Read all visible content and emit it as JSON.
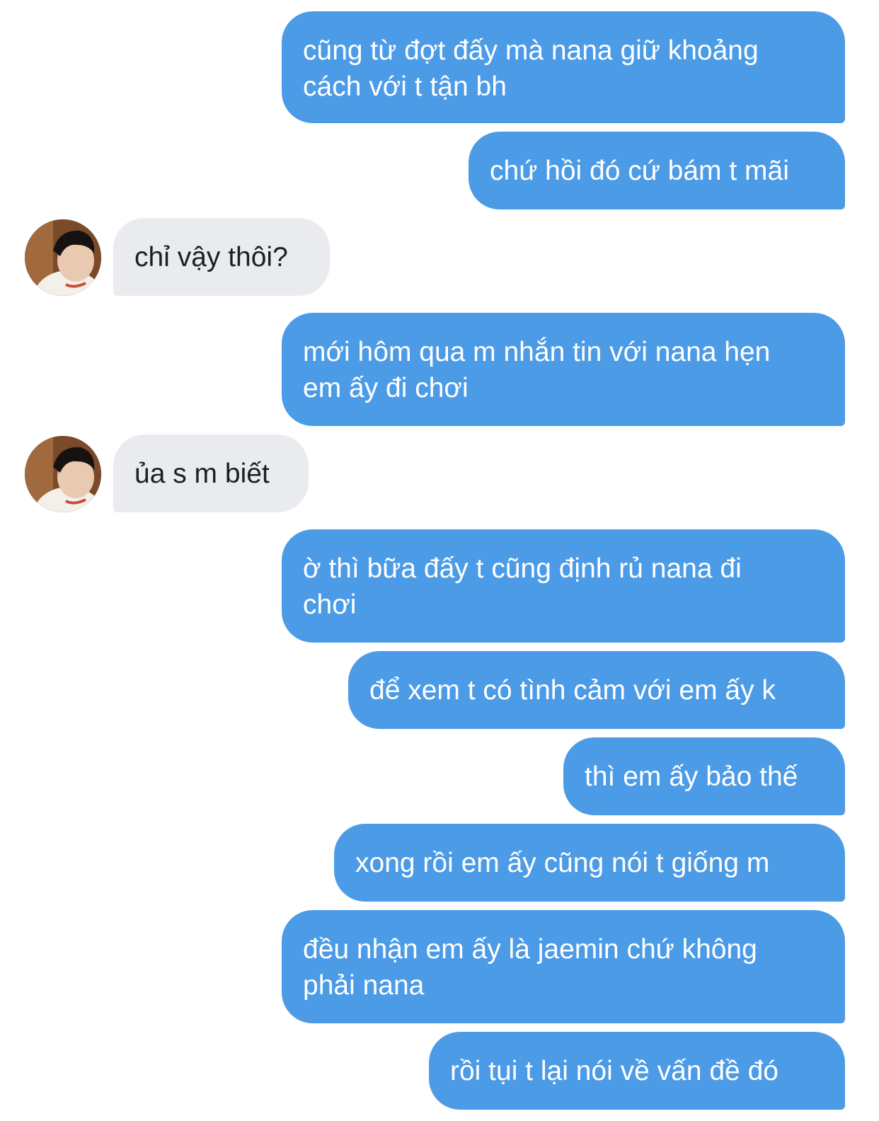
{
  "conversation": {
    "messages": [
      {
        "sender": "me",
        "text": "cũng từ đợt đấy mà nana giữ khoảng\ncách với t tận bh"
      },
      {
        "sender": "me",
        "text": "chứ hồi đó cứ bám t mãi"
      },
      {
        "sender": "them",
        "text": "chỉ vậy thôi?"
      },
      {
        "sender": "me",
        "text": "mới hôm qua m nhắn tin với nana hẹn\nem ấy đi chơi"
      },
      {
        "sender": "them",
        "text": "ủa s m biết"
      },
      {
        "sender": "me",
        "text": "ờ thì bữa đấy t cũng định rủ nana đi\nchơi"
      },
      {
        "sender": "me",
        "text": "để xem t có tình cảm với em ấy k"
      },
      {
        "sender": "me",
        "text": "thì em ấy bảo thế"
      },
      {
        "sender": "me",
        "text": "xong rồi em ấy cũng nói t giống m"
      },
      {
        "sender": "me",
        "text": "đều nhận em ấy là jaemin chứ không\nphải nana"
      },
      {
        "sender": "me",
        "text": "rồi tụi t lại nói về vấn đề đó"
      }
    ]
  },
  "colors": {
    "outgoing_bubble": "#4c9be7",
    "outgoing_text": "#ffffff",
    "incoming_bubble": "#e9ebef",
    "incoming_text": "#1c2026",
    "background": "#ffffff"
  },
  "icons": {
    "contact_avatar": "contact-avatar-photo"
  }
}
